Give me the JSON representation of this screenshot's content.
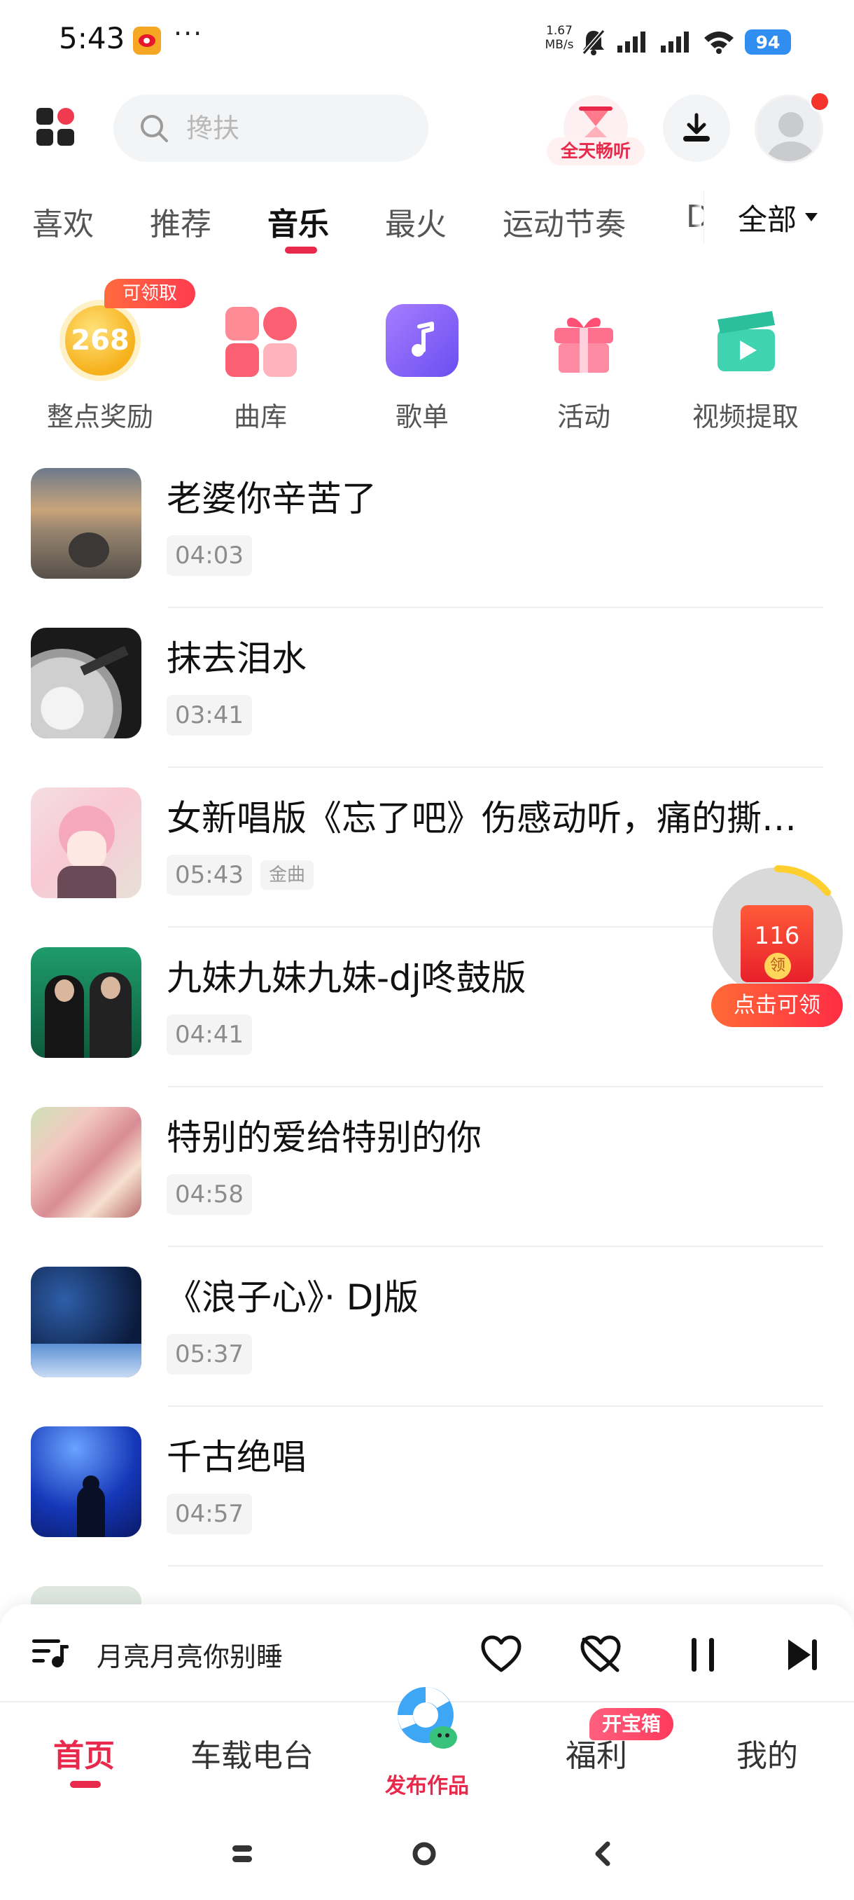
{
  "status_bar": {
    "time": "5:43",
    "more": "···",
    "speed_value": "1.67",
    "speed_unit": "MB/s",
    "battery": "94"
  },
  "header": {
    "search_placeholder": "搀扶",
    "listen_label": "全天畅听"
  },
  "tabs": {
    "items": [
      "喜欢",
      "推荐",
      "音乐",
      "最火",
      "运动节奏",
      "D"
    ],
    "active": "音乐",
    "all_label": "全部"
  },
  "quick_entries": {
    "reward_badge": "可领取",
    "reward_value": "268",
    "items": [
      "整点奖励",
      "曲库",
      "歌单",
      "活动",
      "视频提取"
    ]
  },
  "songs": [
    {
      "title": "老婆你辛苦了",
      "duration": "04:03"
    },
    {
      "title": "抹去泪水",
      "duration": "03:41"
    },
    {
      "title": "女新唱版《忘了吧》伤感动听，痛的撕…",
      "duration": "05:43",
      "tag": "金曲"
    },
    {
      "title": "九妹九妹九妹-dj咚鼓版",
      "duration": "04:41"
    },
    {
      "title": "特别的爱给特别的你",
      "duration": "04:58"
    },
    {
      "title": "《浪子心》· DJ版",
      "duration": "05:37"
    },
    {
      "title": "千古绝唱",
      "duration": "04:57"
    }
  ],
  "red_packet": {
    "amount": "116",
    "coin_text": "领",
    "label": "点击可领"
  },
  "player": {
    "now_playing": "月亮月亮你别睡"
  },
  "bottom_nav": {
    "items": [
      "首页",
      "车载电台",
      "发布作品",
      "福利",
      "我的"
    ],
    "active": "首页",
    "chest_badge": "开宝箱"
  },
  "colors": {
    "accent": "#e8294b",
    "battery": "#2f8ef0",
    "reward": "#f6b01b"
  }
}
